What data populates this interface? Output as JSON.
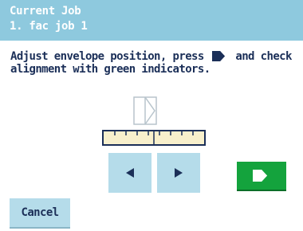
{
  "header": {
    "title": "Current Job",
    "job": "1. fac job 1"
  },
  "instruction": {
    "line1_before_icon": "Adjust envelope position, press ",
    "line1_after_icon": " and check",
    "line2": "alignment with green indicators."
  },
  "buttons": {
    "move_left_icon": "triangle-left-icon",
    "move_right_icon": "triangle-right-icon",
    "confirm_icon": "envelope-flap-icon",
    "cancel_label": "Cancel"
  },
  "colors": {
    "header_bg": "#8ec9de",
    "text": "#1b2f58",
    "button_bg": "#b5dcea",
    "confirm_bg": "#14a33d",
    "ruler_bg": "#f8f0cc"
  }
}
